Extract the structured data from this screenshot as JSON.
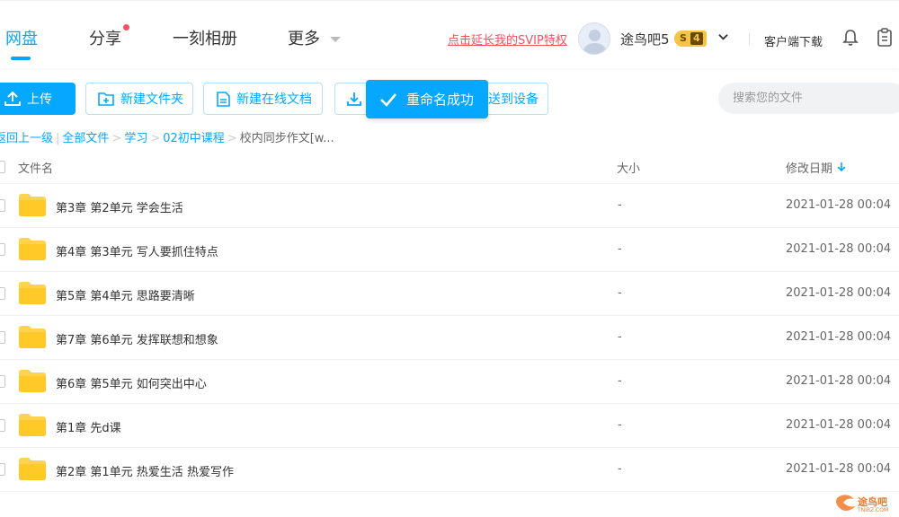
{
  "nav": {
    "tabs": [
      {
        "label": "网盘",
        "active": true
      },
      {
        "label": "分享"
      },
      {
        "label": "一刻相册"
      },
      {
        "label": "更多"
      }
    ],
    "svip_link": "点击延长我的SVIP特权",
    "username": "途鸟吧5",
    "svip_level": "4",
    "svip_letter": "S",
    "client_download": "客户端下载"
  },
  "toolbar": {
    "upload": "上传",
    "new_folder": "新建文件夹",
    "new_doc": "新建在线文档",
    "send_device": "送到设备",
    "toast": "重命名成功",
    "search_placeholder": "搜索您的文件"
  },
  "breadcrumb": {
    "back": "返回上一级",
    "items": [
      "全部文件",
      "学习",
      "02初中课程"
    ],
    "current": "校内同步作文[w..."
  },
  "table": {
    "headers": {
      "name": "文件名",
      "size": "大小",
      "date": "修改日期"
    },
    "rows": [
      {
        "name": "第3章 第2单元 学会生活",
        "size": "-",
        "date": "2021-01-28 00:04"
      },
      {
        "name": "第4章 第3单元 写人要抓住特点",
        "size": "-",
        "date": "2021-01-28 00:04"
      },
      {
        "name": "第5章 第4单元 思路要清晰",
        "size": "-",
        "date": "2021-01-28 00:04"
      },
      {
        "name": "第7章 第6单元 发挥联想和想象",
        "size": "-",
        "date": "2021-01-28 00:04"
      },
      {
        "name": "第6章 第5单元 如何突出中心",
        "size": "-",
        "date": "2021-01-28 00:04"
      },
      {
        "name": "第1章 先d课",
        "size": "-",
        "date": "2021-01-28 00:04"
      },
      {
        "name": "第2章 第1单元 热爱生活 热爱写作",
        "size": "-",
        "date": "2021-01-28 00:04"
      }
    ]
  },
  "watermark": {
    "text": "途鸟吧",
    "sub": "TNIBZ.COM"
  },
  "colors": {
    "accent": "#06a7ff",
    "link_red": "#f5515f",
    "folder": "#ffd24f"
  }
}
